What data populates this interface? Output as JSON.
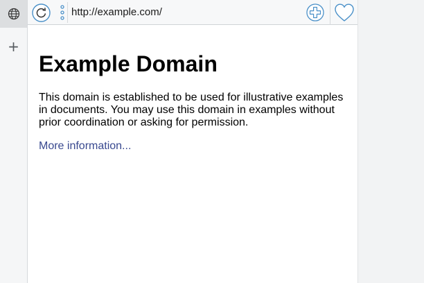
{
  "browser": {
    "url": "http://example.com/",
    "new_tab_symbol": "+",
    "icons": {
      "tab": "globe-icon",
      "reload": "reload-icon",
      "menu": "vertical-dots-icon",
      "add": "plus-circle-icon",
      "favorite": "heart-icon"
    },
    "colors": {
      "accent": "#4a90c8",
      "link": "#38488f"
    }
  },
  "page": {
    "heading": "Example Domain",
    "paragraph": "This domain is established to be used for illustrative examples in documents. You may use this domain in examples without prior coordination or asking for permission.",
    "link_text": "More information..."
  }
}
